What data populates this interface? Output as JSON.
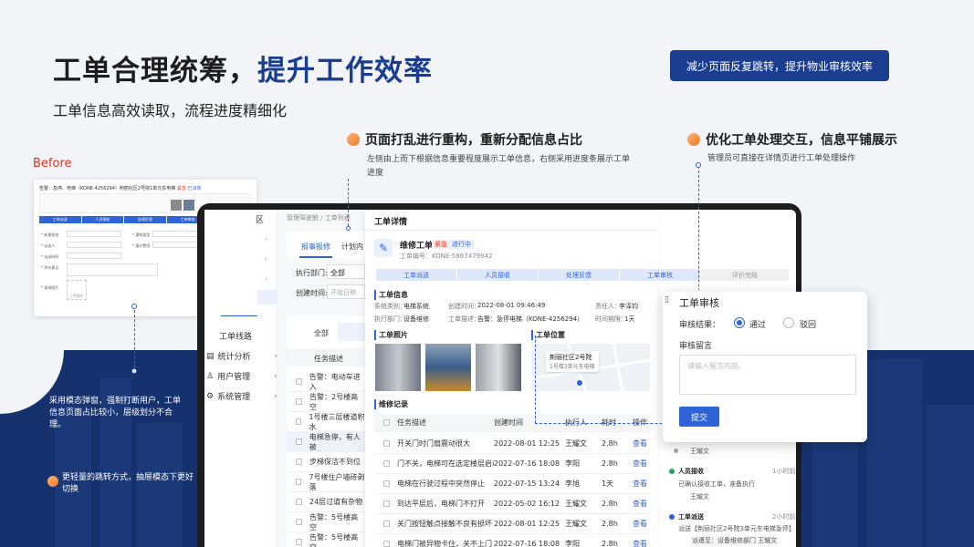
{
  "headline": {
    "part1": "工单合理统筹",
    "sep": "，",
    "part2": "提升工作效率"
  },
  "subline": "工单信息高效读取，流程进度精细化",
  "tag": "减少页面反复跳转，提升物业审核效率",
  "point1": {
    "title": "页面打乱进行重构，重新分配信息占比",
    "desc": "左侧由上而下根据信息重要程度展示工单信息，右侧采用进度条展示工单进度"
  },
  "point2": {
    "title": "优化工单处理交互，信息平铺展示",
    "desc": "管理员可直接在详情页进行工单处理操作"
  },
  "before_label": "Before",
  "old_screen": {
    "line1": "告警：急停、电梯（KONE-4256294）荆丽社区2号院1单元东电梯",
    "badge1": "紧急",
    "badge2": "已派单",
    "steps": [
      "工单派送",
      "人员接收",
      "处理反馈",
      "工单审核",
      "评价完结"
    ],
    "fields": [
      "* 处理状态",
      "* 派送人",
      "* 派送时间",
      "* 评价意见",
      "* 现场照片"
    ],
    "field2": [
      "* 通知类型",
      "* 报价费用"
    ],
    "upload": "上传照片"
  },
  "left_desc": "采用模态弹窗，强制打断用户，工单信息页面占比较小，层级划分不合理。",
  "left_note": "更轻量的跳转方式，抽屉模态下更好切换",
  "app": {
    "sidebar_tail": "区",
    "sidebar_items": [
      {
        "icon": "user-icon",
        "label": "工单线路"
      },
      {
        "icon": "chart-icon",
        "label": "统计分析"
      },
      {
        "icon": "person-icon",
        "label": "用户管理"
      },
      {
        "icon": "gear-icon",
        "label": "系统管理"
      }
    ],
    "breadcrumb": "管理驾驶舱 / 工单列表",
    "tabs": [
      "报事报修",
      "计划内"
    ],
    "filter_dept": "执行部门:",
    "filter_dept_val": "全部",
    "filter_time": "创建时间:",
    "filter_time_ph": "开始日期",
    "filter_all": "全部",
    "bg_col": "任务描述",
    "bg_rows": [
      "告警：电动车进入",
      "告警：2号楼高空",
      "1号楼三层楼道积水",
      "电梯急停，有人被",
      "步梯保洁不到位",
      "7号楼住户墙砖剥落",
      "24层过道有杂物",
      "告警：5号楼高空",
      "告警：5号楼高空"
    ]
  },
  "detail": {
    "title": "工单详情",
    "order_type": "维修工单",
    "badge_urgent": "紧急",
    "badge_status": "进行中",
    "order_no": "工单编号：KONE-5867479942",
    "steps": [
      "工单派送",
      "人员接收",
      "处理反馈",
      "工单审核",
      "评价完结"
    ],
    "info_title": "工单信息",
    "info": [
      {
        "k": "系统类别：",
        "v": "电梯系统"
      },
      {
        "k": "创建时间：",
        "v": "2022-08-01  09:46:49"
      },
      {
        "k": "责任人：",
        "v": "李泽钧"
      },
      {
        "k": "执行部门：",
        "v": "设备维修"
      },
      {
        "k": "工单描述：",
        "v": "告警：急停电梯（KONE-4256294）"
      },
      {
        "k": "时间期限：",
        "v": "1天"
      }
    ],
    "photo_title": "工单照片",
    "loc_title": "工单位置",
    "loc_name": "荆丽社区2号院",
    "loc_sub": "1号楼3单元东电梯",
    "records_title": "维修记录",
    "cols": [
      "任务描述",
      "创建时间",
      "执行人",
      "耗时",
      "操作"
    ],
    "rows": [
      {
        "d": "开关门时门扇震动很大",
        "t": "2022-08-01  12:25",
        "p": "王耀文",
        "h": "2.8h",
        "a": "查看"
      },
      {
        "d": "门不关，电梯可在选定楼层启动",
        "t": "2022-07-16  18:08",
        "p": "李阳",
        "h": "2.8h",
        "a": "查看"
      },
      {
        "d": "电梯在行驶过程中突然停止",
        "t": "2022-07-15  13:24",
        "p": "李旭",
        "h": "1天",
        "a": "查看"
      },
      {
        "d": "到达平层后，电梯门不打开",
        "t": "2022-05-02  16:12",
        "p": "王耀文",
        "h": "2.8h",
        "a": "查看"
      },
      {
        "d": "关门按钮触点接触不良有损坏",
        "t": "2022-08-01  12:25",
        "p": "王耀文",
        "h": "2.8h",
        "a": "查看"
      },
      {
        "d": "电梯门被异物卡住，关不上门",
        "t": "2022-07-16  18:08",
        "p": "李阳",
        "h": "2.8h",
        "a": "查看"
      }
    ]
  },
  "modal": {
    "title": "工单审核",
    "result_label": "审核结果：",
    "opt_pass": "通过",
    "opt_reject": "驳回",
    "comment_label": "审核留言",
    "placeholder": "请输入留言内容。",
    "submit": "提交"
  },
  "timeline": [
    {
      "name": "王耀文"
    },
    {
      "title": "人员接收",
      "time": "1小时前",
      "desc": "已确认接收工单，准备执行",
      "name": "王耀文"
    },
    {
      "title": "工单派送",
      "time": "2小时前",
      "desc": "派送【荆丽社区2号院3单元东电梯急停】",
      "sub": "派遣至：设备维修部门  王耀文"
    }
  ],
  "colors": {
    "brand": "#1b3d8f",
    "accent": "#2f63d8",
    "alert": "#e0321e",
    "band": "#16326e"
  }
}
